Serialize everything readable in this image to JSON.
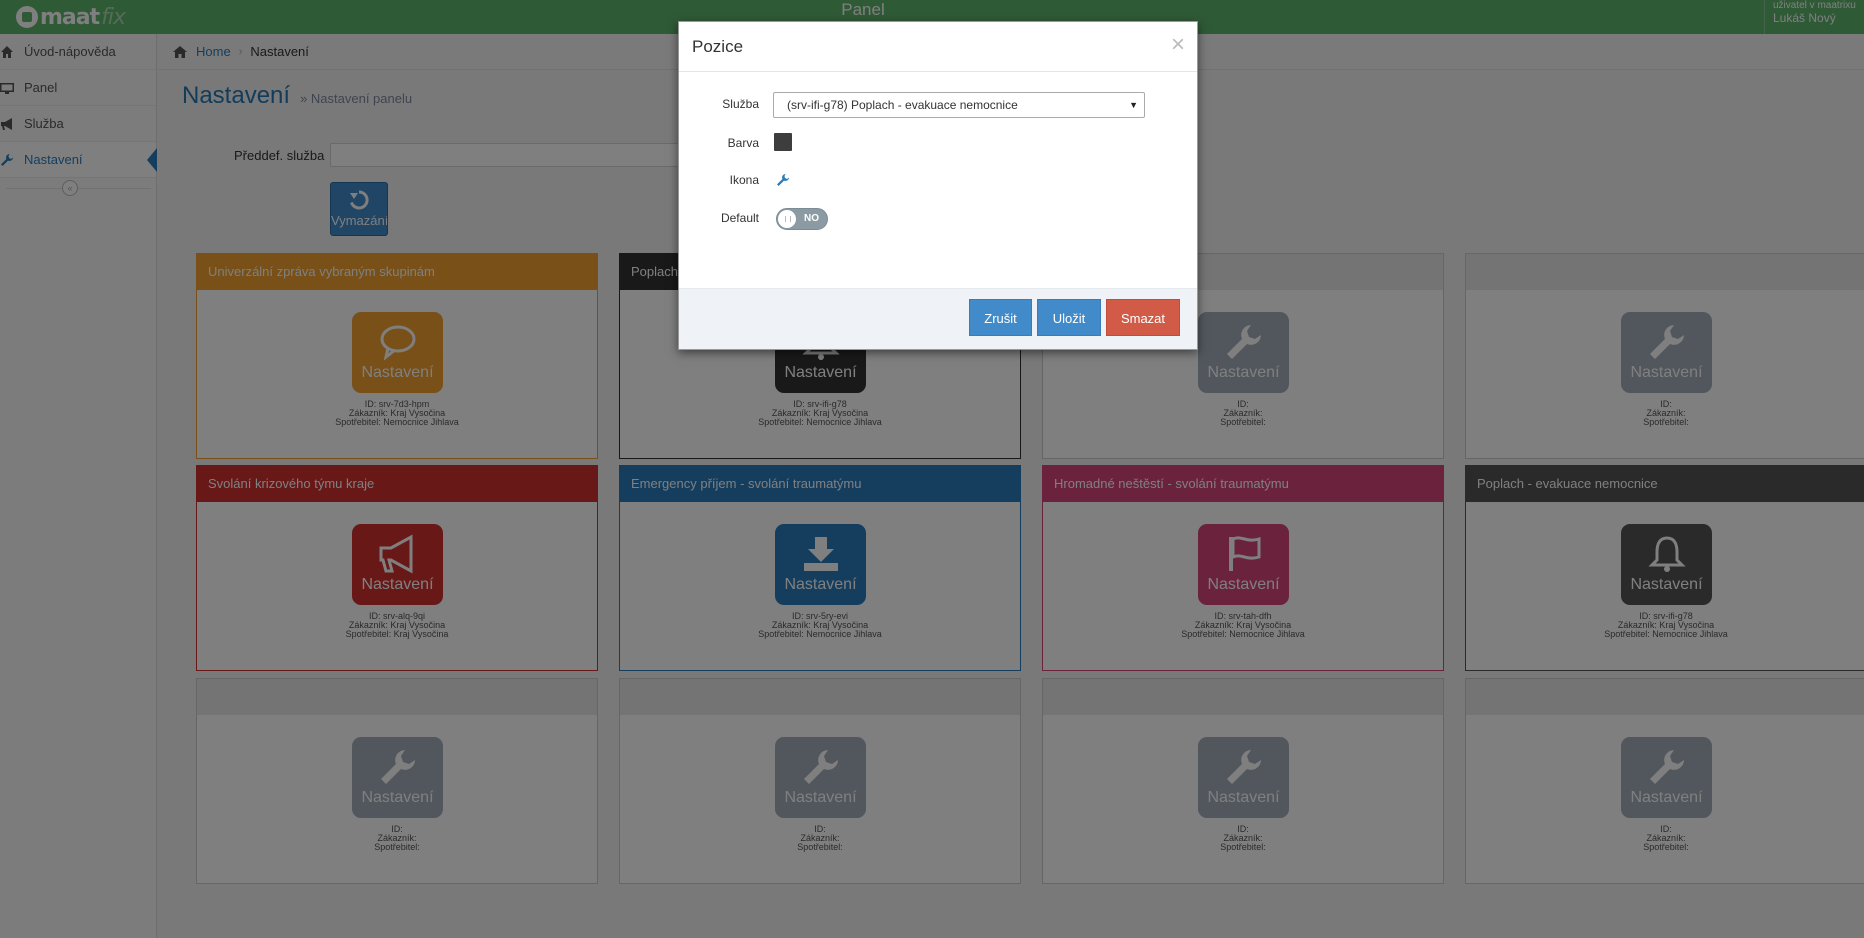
{
  "app": {
    "logo_text": "maat",
    "logo_suffix": "fix",
    "title": "Panel",
    "user_subtitle": "uživatel v maatrixu",
    "user_name": "Lukáš Nový"
  },
  "sidebar": {
    "items": [
      {
        "label": "Úvod-nápověda",
        "icon": "home-icon"
      },
      {
        "label": "Panel",
        "icon": "monitor-icon"
      },
      {
        "label": "Služba",
        "icon": "bullhorn-icon"
      },
      {
        "label": "Nastavení",
        "icon": "wrench-icon",
        "active": true
      }
    ],
    "collapse_glyph": "«"
  },
  "breadcrumbs": {
    "home": "Home",
    "current": "Nastavení"
  },
  "page": {
    "title": "Nastavení",
    "subtitle": "Nastavení panelu"
  },
  "preset": {
    "label": "Předdef. služba",
    "value": "",
    "clear_button": "Vymazání"
  },
  "tiles": [
    {
      "title": "Univerzální zpráva vybraným skupinám",
      "button": "Nastavení",
      "icon": "comment-icon",
      "color": "#f0a030",
      "id": "ID: srv-7d3-hpm",
      "customer": "Zákazník: Kraj Vysočina",
      "consumer": "Spotřebitel: Nemocnice Jihlava"
    },
    {
      "title": "Poplach",
      "button": "Nastavení",
      "icon": "bell-icon",
      "color": "#333333",
      "id": "ID: srv-ifi-g78",
      "customer": "Zákazník: Kraj Vysočina",
      "consumer": "Spotřebitel: Nemocnice Jihlava"
    },
    {
      "title": "",
      "button": "Nastavení",
      "icon": "wrench-icon",
      "color": "#a5aebc",
      "id": "ID:",
      "customer": "Zákazník:",
      "consumer": "Spotřebitel:"
    },
    {
      "title": "",
      "button": "Nastavení",
      "icon": "wrench-icon",
      "color": "#a5aebc",
      "id": "ID:",
      "customer": "Zákazník:",
      "consumer": "Spotřebitel:"
    },
    {
      "title": "Svolání krizového týmu kraje",
      "button": "Nastavení",
      "icon": "bullhorn-icon",
      "color": "#d23030",
      "id": "ID: srv-alq-9qi",
      "customer": "Zákazník: Kraj Vysočina",
      "consumer": "Spotřebitel: Kraj Vysočina"
    },
    {
      "title": "Emergency příjem - svolání traumatýmu",
      "button": "Nastavení",
      "icon": "download-icon",
      "color": "#2a7bbd",
      "id": "ID: srv-5ry-evi",
      "customer": "Zákazník: Kraj Vysočina",
      "consumer": "Spotřebitel: Nemocnice Jihlava"
    },
    {
      "title": "Hromadné neštěstí - svolání traumatýmu",
      "button": "Nastavení",
      "icon": "flag-icon",
      "color": "#d6457a",
      "id": "ID: srv-tah-dfh",
      "customer": "Zákazník: Kraj Vysočina",
      "consumer": "Spotřebitel: Nemocnice Jihlava"
    },
    {
      "title": "Poplach - evakuace nemocnice",
      "button": "Nastavení",
      "icon": "bell-icon",
      "color": "#555555",
      "id": "ID: srv-ifi-g78",
      "customer": "Zákazník: Kraj Vysočina",
      "consumer": "Spotřebitel: Nemocnice Jihlava"
    },
    {
      "title": "",
      "button": "Nastavení",
      "icon": "wrench-icon",
      "color": "#a5aebc",
      "id": "ID:",
      "customer": "Zákazník:",
      "consumer": "Spotřebitel:"
    },
    {
      "title": "",
      "button": "Nastavení",
      "icon": "wrench-icon",
      "color": "#a5aebc",
      "id": "ID:",
      "customer": "Zákazník:",
      "consumer": "Spotřebitel:"
    },
    {
      "title": "",
      "button": "Nastavení",
      "icon": "wrench-icon",
      "color": "#a5aebc",
      "id": "ID:",
      "customer": "Zákazník:",
      "consumer": "Spotřebitel:"
    },
    {
      "title": "",
      "button": "Nastavení",
      "icon": "wrench-icon",
      "color": "#a5aebc",
      "id": "ID:",
      "customer": "Zákazník:",
      "consumer": "Spotřebitel:"
    }
  ],
  "modal": {
    "title": "Pozice",
    "close": "×",
    "service_label": "Služba",
    "service_value": "(srv-ifi-g78) Poplach - evakuace nemocnice",
    "color_label": "Barva",
    "color_value": "#3d3d3d",
    "icon_label": "Ikona",
    "icon_value": "wrench-icon",
    "default_label": "Default",
    "default_toggle_text": "NO",
    "cancel_button": "Zrušit",
    "save_button": "Uložit",
    "delete_button": "Smazat"
  }
}
